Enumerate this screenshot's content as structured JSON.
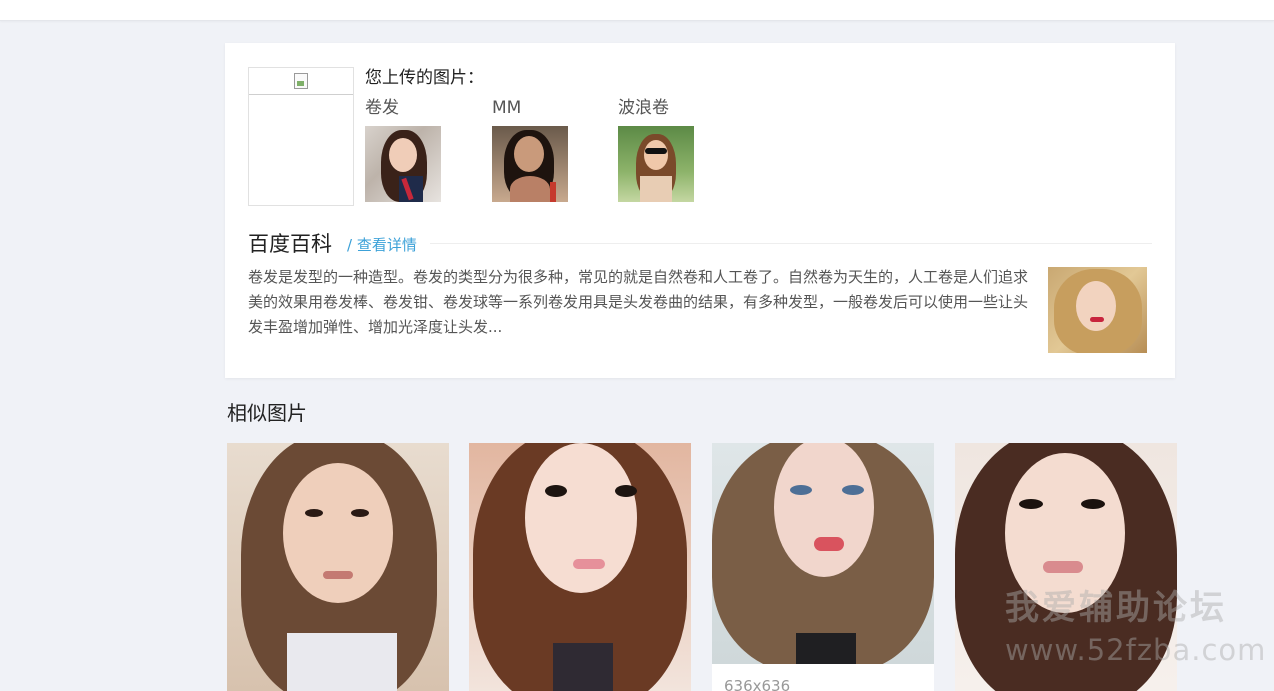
{
  "upload": {
    "title": "您上传的图片：",
    "tags": [
      {
        "label": "卷发"
      },
      {
        "label": "MM"
      },
      {
        "label": "波浪卷"
      }
    ]
  },
  "baike": {
    "title": "百度百科",
    "link": "/ 查看详情",
    "text": "卷发是发型的一种造型。卷发的类型分为很多种，常见的就是自然卷和人工卷了。自然卷为天生的，人工卷是人们追求美的效果用卷发棒、卷发钳、卷发球等一系列卷发用具是头发卷曲的结果，有多种发型，一般卷发后可以使用一些让头发丰盈增加弹性、增加光泽度让头发..."
  },
  "similar": {
    "title": "相似图片",
    "items": [
      {
        "caption": ""
      },
      {
        "caption": ""
      },
      {
        "caption": "636x636"
      },
      {
        "caption": ""
      }
    ]
  },
  "watermark": {
    "line1": "我爱辅助论坛",
    "line2": "www.52fzba.com"
  }
}
